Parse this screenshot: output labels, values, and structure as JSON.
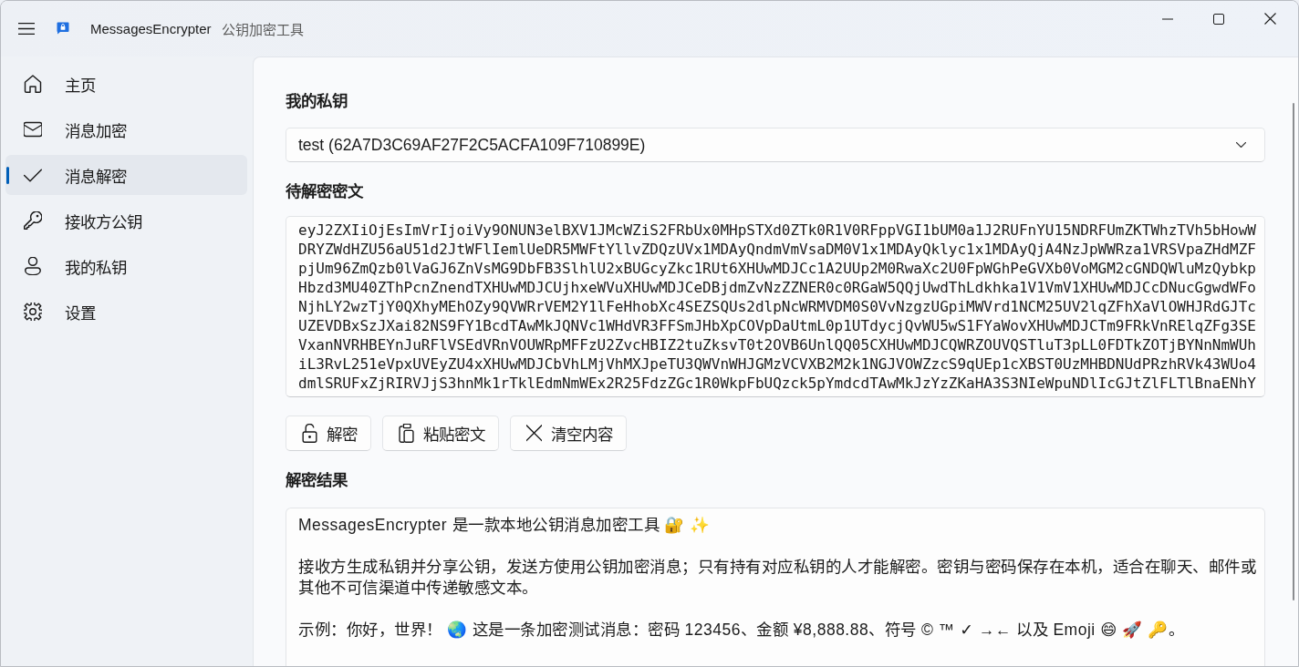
{
  "title_bar": {
    "app_name": "MessagesEncrypter",
    "subtitle": "公钥加密工具"
  },
  "sidebar": {
    "items": [
      {
        "label": "主页",
        "selected": false
      },
      {
        "label": "消息加密",
        "selected": false
      },
      {
        "label": "消息解密",
        "selected": true
      },
      {
        "label": "接收方公钥",
        "selected": false
      },
      {
        "label": "我的私钥",
        "selected": false
      },
      {
        "label": "设置",
        "selected": false
      }
    ]
  },
  "private_key": {
    "heading": "我的私钥",
    "value": "test (62A7D3C69AF27F2C5ACFA109F710899E)"
  },
  "ciphertext": {
    "heading": "待解密密文",
    "value": "eyJ2ZXIiOjEsImVrIjoiVy9ONUN3elBXV1JMcWZiS2FRbUx0MHpSTXd0ZTk0R1V0RFppVGI1bUM0a1J2RUFnYU15NDRFUmZKTWhzTVh5bHowWDRYZWdHZU56aU51d2JtWFlIemlUeDR5MWFtYllvZDQzUVx1MDAyQndmVmVsaDM0V1x1MDAyQklyc1x1MDAyQjA4NzJpWWRza1VRSVpaZHdMZFpjUm96ZmQzb0lVaGJ6ZnVsMG9DbFB3SlhlU2xBUGcyZkc1RUt6XHUwMDJCc1A2UUp2M0RwaXc2U0FpWGhPeGVXb0VoMGM2cGNDQWluMzQybkpHbzd3MU40ZThPcnZnendTXHUwMDJCUjhxeWVuXHUwMDJCeDBjdmZvNzZZNER0c0RGaW5QQjUwdThLdkhka1V1VmV1XHUwMDJCcDNucGgwdWFoNjhLY2wzTjY0QXhyMEhOZy9QVWRrVEM2Y1lFeHhobXc4SEZSQUs2dlpNcWRMVDM0S0VvNzgzUGpiMWVrd1NCM25UV2lqZFhXaVlOWHJRdGJTcUZEVDBxSzJXai82NS9FY1BcdTAwMkJQNVc1WHdVR3FFSmJHbXpCOVpDaUtmL0p1UTdycjQvWU5wS1FYaWovXHUwMDJCTm9FRkVnRElqZFg3SEVxanNVRHBEYnJuRFlVSEdVRnVOUWRpMFFzU2ZvcHBIZ2tuZksvT0t2OVB6UnlQQ05CXHUwMDJCQWRZOUVQSTluT3pLL0FDTkZOTjBYNnNmWUhiL3RvL251eVpxUVEyZU4xXHUwMDJCbVhLMjVhMXJpeTU3QWVnWHJGMzVCVXB2M2k1NGJVOWZzcS9qUEp1cXBST0UzMHBDNUdPRzhRVk43WUo4dmlSRUFxZjRIRVJjS3hnMk1rTklEdmNmWEx2R25FdzZGc1R0WkpFbUQzck5pYmdcdTAwMkJzYzZKaHA3S3NIeWpuNDlIcGJtZlFLTlBnaENhY"
  },
  "actions": [
    "解密",
    "粘贴密文",
    "清空内容"
  ],
  "result": {
    "heading": "解密结果",
    "paragraphs": [
      "MessagesEncrypter 是一款本地公钥消息加密工具 🔐 ✨",
      "接收方生成私钥并分享公钥，发送方使用公钥加密消息；只有持有对应私钥的人才能解密。密钥与密码保存在本机，适合在聊天、邮件或其他不可信渠道中传递敏感文本。",
      "示例：你好，世界！ 🌏 这是一条加密测试消息：密码 123456、金额 ¥8,888.88、符号 © ™ ✓ →← 以及 Emoji 😄 🚀 🔑。"
    ]
  }
}
